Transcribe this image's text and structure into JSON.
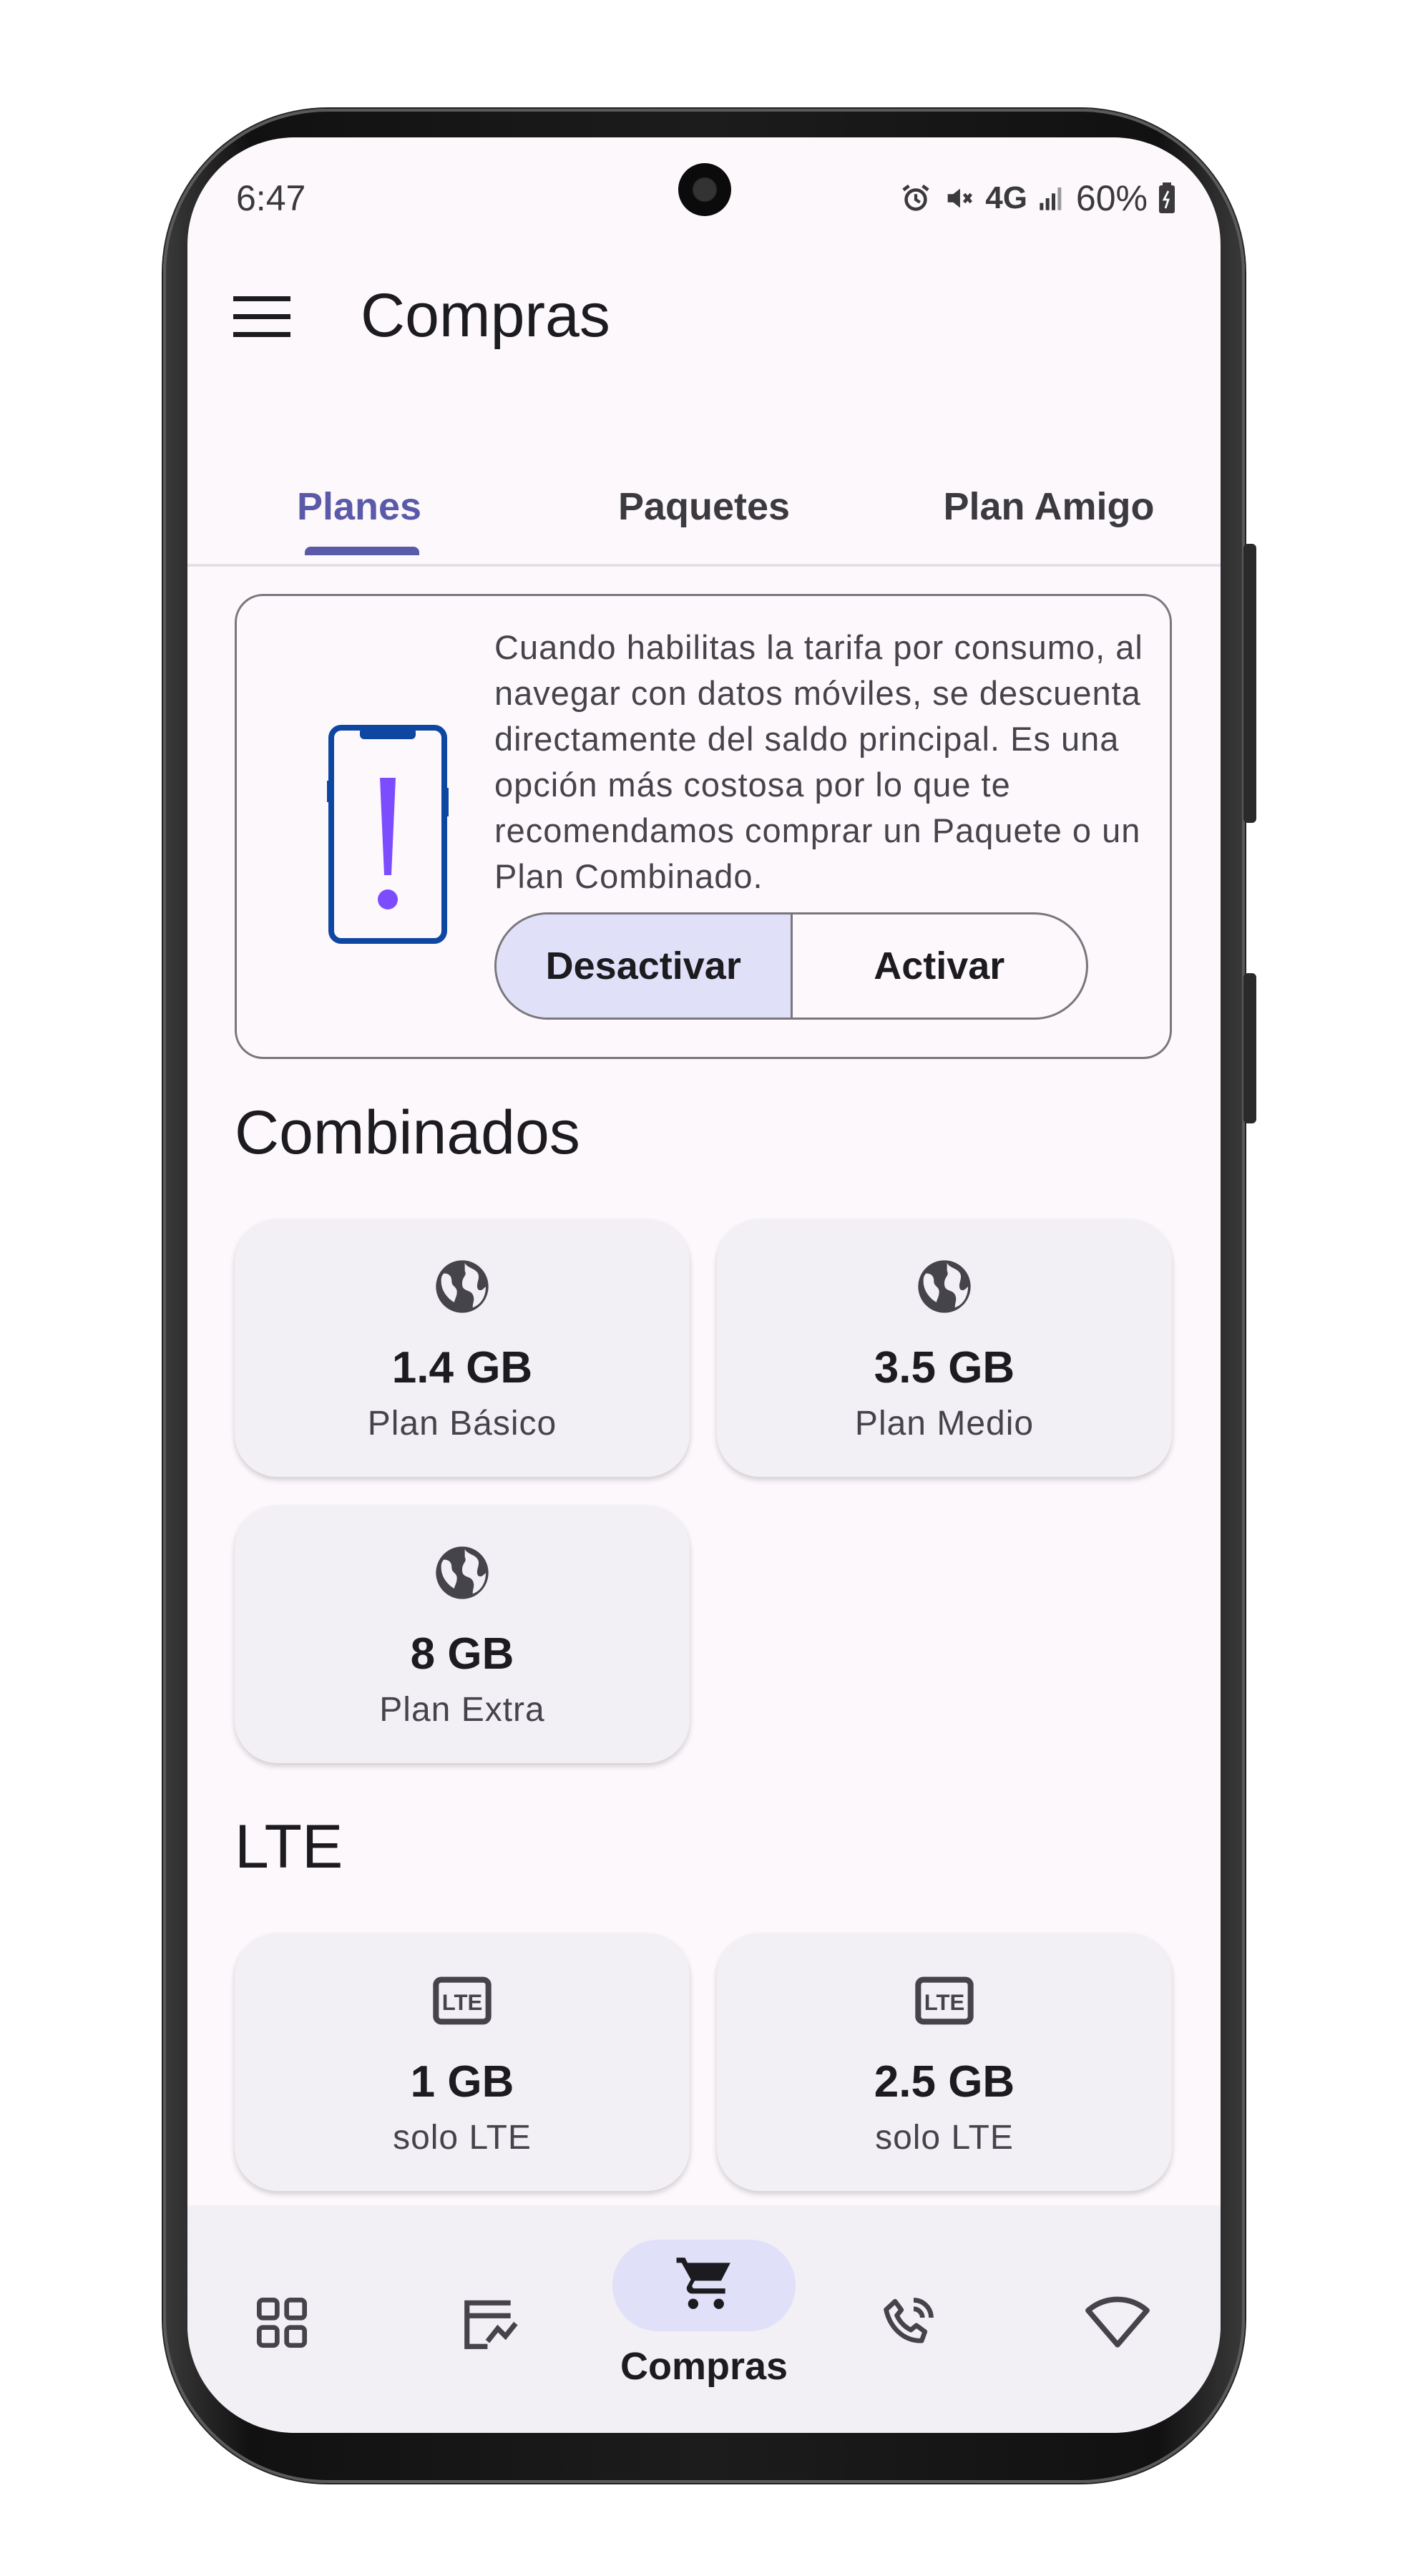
{
  "status_bar": {
    "time": "6:47",
    "network": "4G",
    "battery": "60%"
  },
  "app_bar": {
    "title": "Compras",
    "menu_icon": "menu-icon"
  },
  "tabs": [
    {
      "label": "Planes",
      "active": true
    },
    {
      "label": "Paquetes",
      "active": false
    },
    {
      "label": "Plan Amigo",
      "active": false
    }
  ],
  "info_card": {
    "icon": "phone-alert-icon",
    "text": "Cuando habilitas la tarifa por consumo, al navegar con datos móviles, se descuenta directamente del saldo principal. Es una opción más costosa por lo que te recomendamos comprar un Paquete o un Plan Combinado.",
    "toggle": {
      "options": [
        "Desactivar",
        "Activar"
      ],
      "selected": "Desactivar"
    }
  },
  "sections": [
    {
      "title": "Combinados",
      "icon": "globe-icon",
      "plans": [
        {
          "size": "1.4 GB",
          "name": "Plan Básico"
        },
        {
          "size": "3.5 GB",
          "name": "Plan Medio"
        },
        {
          "size": "8 GB",
          "name": "Plan Extra"
        }
      ]
    },
    {
      "title": "LTE",
      "icon": "lte-icon",
      "plans": [
        {
          "size": "1 GB",
          "name": "solo LTE"
        },
        {
          "size": "2.5 GB",
          "name": "solo LTE"
        }
      ]
    }
  ],
  "bottom_nav": {
    "items": [
      {
        "icon": "dashboard-grid-icon",
        "label": ""
      },
      {
        "icon": "usage-chart-icon",
        "label": ""
      },
      {
        "icon": "cart-icon",
        "label": "Compras",
        "active": true
      },
      {
        "icon": "phone-call-icon",
        "label": ""
      },
      {
        "icon": "wifi-icon",
        "label": ""
      }
    ]
  },
  "colors": {
    "primary": "#5b5aa8",
    "surface": "#fdf8fc",
    "card": "#f2eff5",
    "selected_container": "#e1e0f9",
    "alert_purple": "#7c4dff",
    "phone_outline_blue": "#0d47a1"
  }
}
